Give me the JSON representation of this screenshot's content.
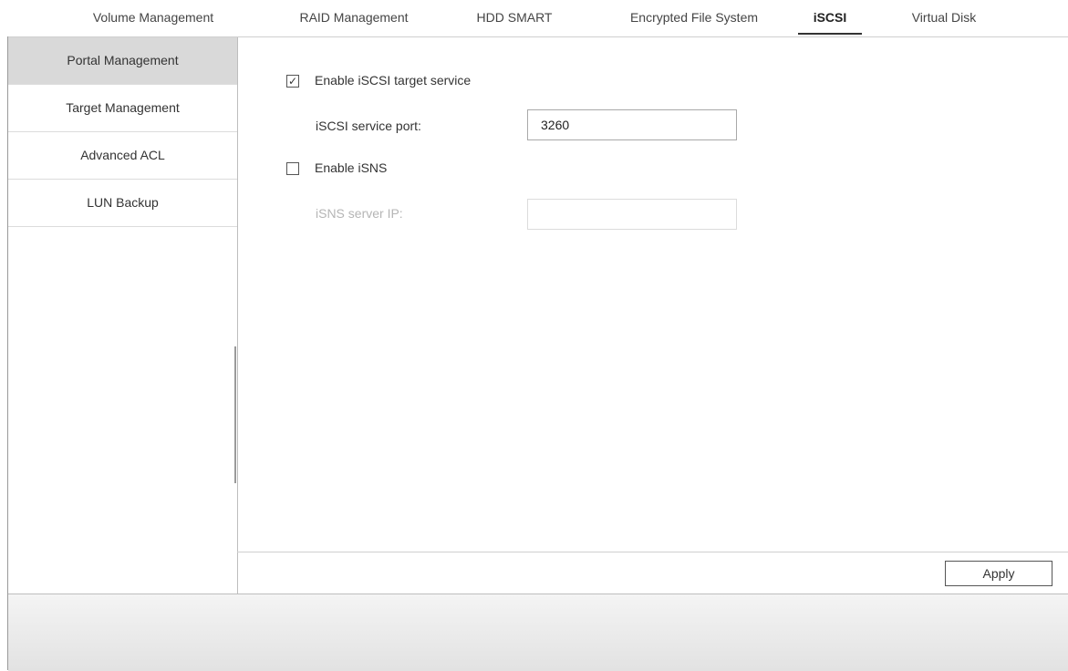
{
  "tabs": [
    {
      "label": "Volume Management"
    },
    {
      "label": "RAID Management"
    },
    {
      "label": "HDD SMART"
    },
    {
      "label": "Encrypted File System"
    },
    {
      "label": "iSCSI"
    },
    {
      "label": "Virtual Disk"
    }
  ],
  "active_tab": "iSCSI",
  "sidebar": {
    "items": [
      {
        "label": "Portal Management"
      },
      {
        "label": "Target Management"
      },
      {
        "label": "Advanced ACL"
      },
      {
        "label": "LUN Backup"
      }
    ],
    "active_item": "Portal Management"
  },
  "form": {
    "enable_target_service": {
      "label": "Enable iSCSI target service",
      "checked": true,
      "mark": "✓"
    },
    "service_port": {
      "label": "iSCSI service port:",
      "value": "3260"
    },
    "enable_isns": {
      "label": "Enable iSNS",
      "checked": false
    },
    "isns_server_ip": {
      "label": "iSNS server IP:",
      "value": "",
      "disabled": true
    }
  },
  "footer": {
    "apply_label": "Apply"
  },
  "icons": {
    "checkbox_checked": "checkbox-checked-icon",
    "checkbox_unchecked": "checkbox-unchecked-icon"
  }
}
